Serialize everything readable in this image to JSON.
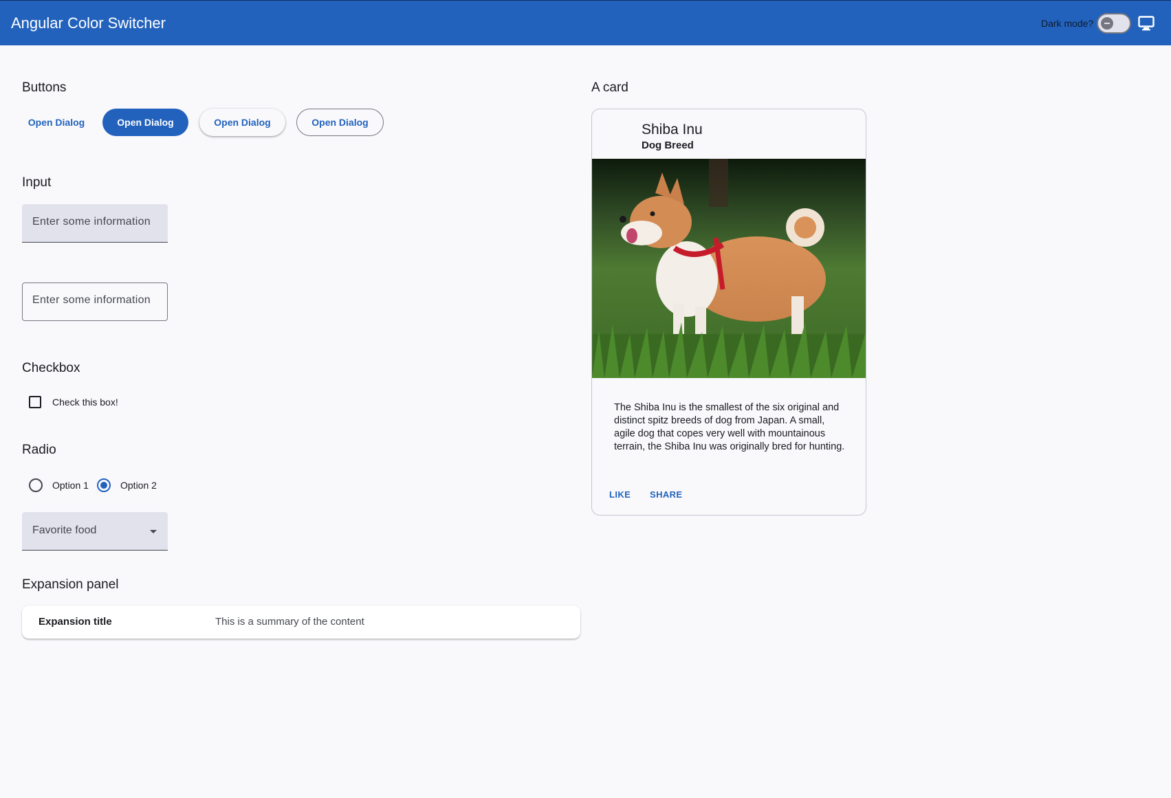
{
  "toolbar": {
    "title": "Angular Color Switcher",
    "dark_mode_label": "Dark mode?",
    "dark_mode_on": false,
    "display_icon": "monitor-icon"
  },
  "sections": {
    "buttons": "Buttons",
    "input": "Input",
    "checkbox": "Checkbox",
    "radio": "Radio",
    "expansion": "Expansion panel",
    "card": "A card"
  },
  "buttons": {
    "text_label": "Open Dialog",
    "filled_label": "Open Dialog",
    "elevated_label": "Open Dialog",
    "outlined_label": "Open Dialog"
  },
  "inputs": {
    "filled_placeholder": "Enter some information",
    "outlined_placeholder": "Enter some information"
  },
  "checkbox": {
    "label": "Check this box!",
    "checked": false
  },
  "radio": {
    "options": [
      {
        "label": "Option 1",
        "checked": false
      },
      {
        "label": "Option 2",
        "checked": true
      }
    ]
  },
  "select": {
    "label": "Favorite food"
  },
  "expansion": {
    "title": "Expansion title",
    "summary": "This is a summary of the content"
  },
  "card": {
    "title": "Shiba Inu",
    "subtitle": "Dog Breed",
    "text": "The Shiba Inu is the smallest of the six original and distinct spitz breeds of dog from Japan. A small, agile dog that copes very well with mountainous terrain, the Shiba Inu was originally bred for hunting.",
    "actions": [
      "LIKE",
      "SHARE"
    ]
  },
  "colors": {
    "primary": "#2262bd",
    "background": "#f9f9fc",
    "surface_variant": "#e1e2ec"
  }
}
